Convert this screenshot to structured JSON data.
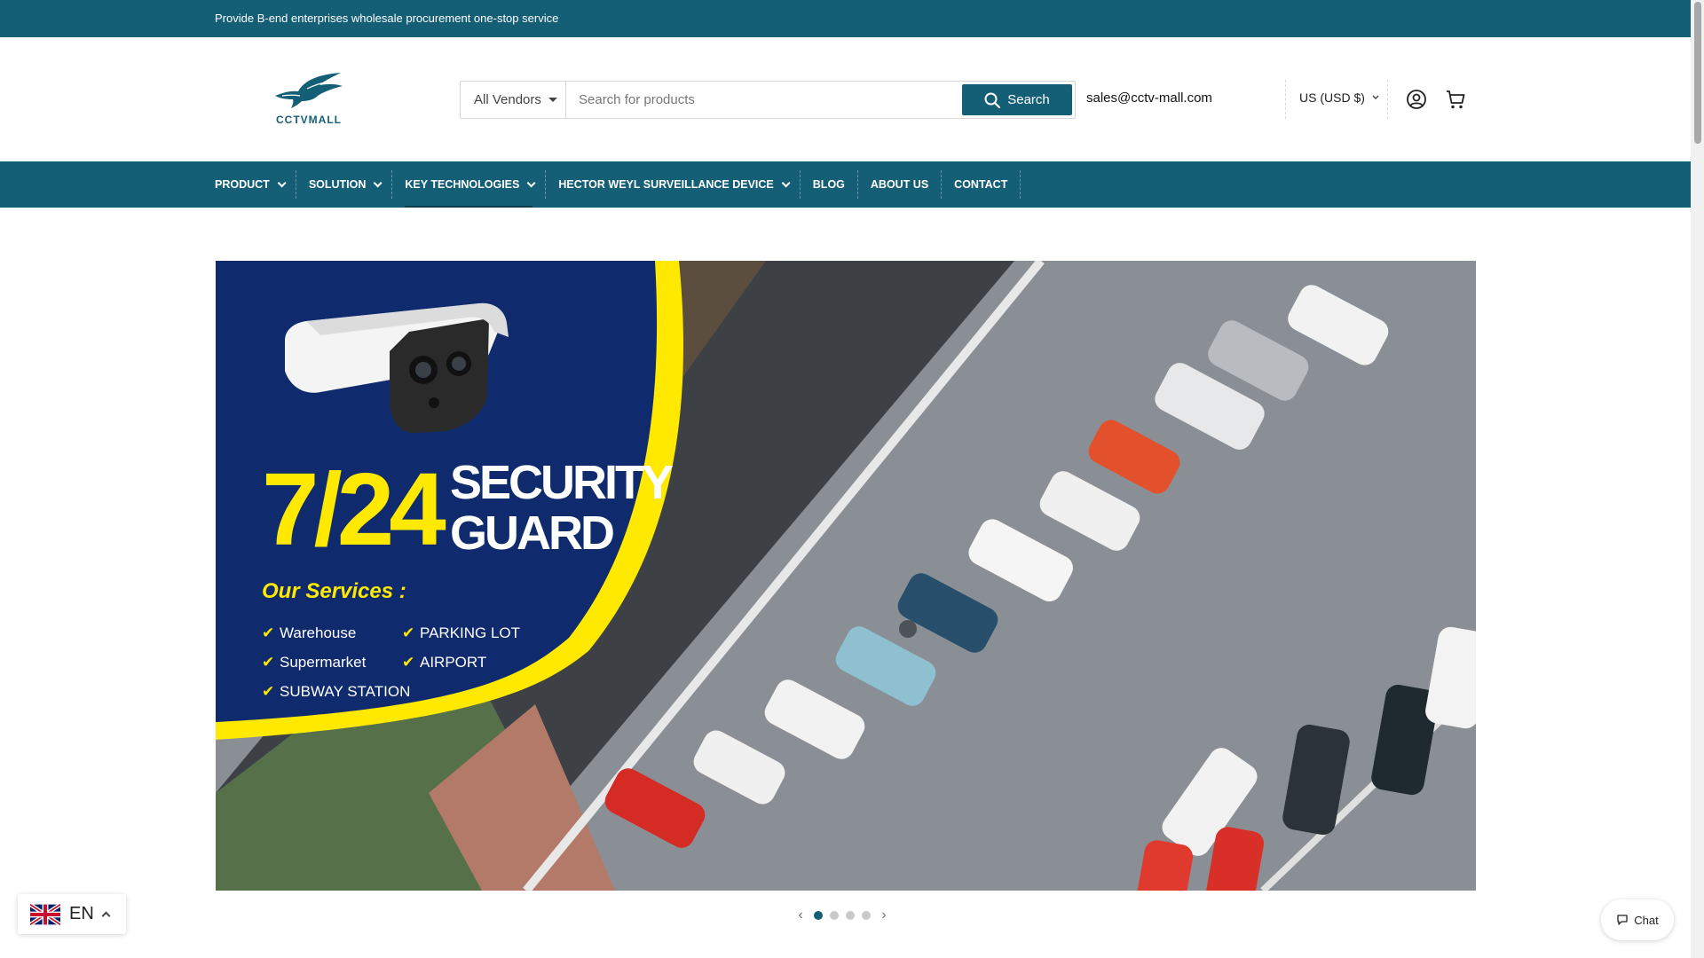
{
  "announcement": {
    "text": "Provide B-end enterprises wholesale procurement one-stop service"
  },
  "logo": {
    "text": "CCTVMALL"
  },
  "search": {
    "vendor_label": "All Vendors",
    "placeholder": "Search for products",
    "button_label": "Search"
  },
  "header": {
    "email": "sales@cctv-mall.com",
    "currency": "US (USD $)"
  },
  "icons": {
    "account": "user-circle-icon",
    "cart": "cart-icon",
    "search": "search-icon",
    "chat": "chat-bubble-icon",
    "flag": "uk-flag-icon"
  },
  "nav": {
    "items": [
      {
        "label": "PRODUCT",
        "has_dropdown": true
      },
      {
        "label": "SOLUTION",
        "has_dropdown": true
      },
      {
        "label": "KEY TECHNOLOGIES",
        "has_dropdown": true
      },
      {
        "label": "HECTOR WEYL SURVEILLANCE DEVICE",
        "has_dropdown": true
      },
      {
        "label": "BLOG",
        "has_dropdown": false
      },
      {
        "label": "ABOUT US",
        "has_dropdown": false
      },
      {
        "label": "CONTACT",
        "has_dropdown": false
      }
    ]
  },
  "hero": {
    "headline_number": "7/24",
    "headline_line1": "SECURITY",
    "headline_line2": "GUARD",
    "services_title": "Our Services :",
    "services": [
      "Warehouse",
      "PARKING LOT",
      "Supermarket",
      "AIRPORT",
      "SUBWAY STATION"
    ],
    "slide_count": 4,
    "active_slide": 1
  },
  "language": {
    "label": "EN"
  },
  "chat": {
    "label": "Chat"
  },
  "colors": {
    "brand": "#155f76",
    "hero_navy": "#0f2b6e",
    "accent_yellow": "#ffe900"
  }
}
